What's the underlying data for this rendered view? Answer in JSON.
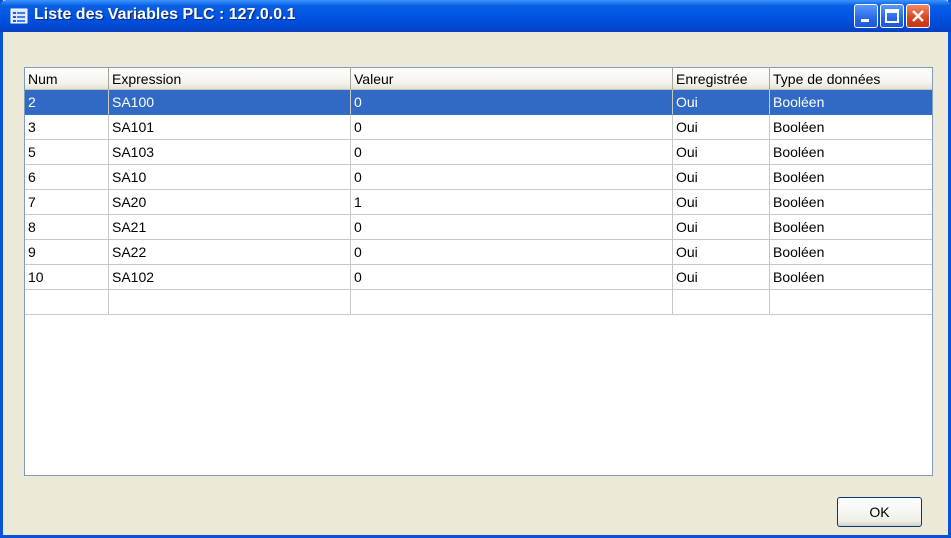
{
  "window": {
    "title": "Liste des Variables PLC : 127.0.0.1",
    "colors": {
      "titlebar": "#0054e3",
      "selection": "#316ac5",
      "frame": "#ece9d8"
    }
  },
  "table": {
    "columns": [
      "Num",
      "Expression",
      "Valeur",
      "Enregistrée",
      "Type de données"
    ],
    "rows": [
      [
        "2",
        "SA100",
        "0",
        "Oui",
        "Booléen"
      ],
      [
        "3",
        "SA101",
        "0",
        "Oui",
        "Booléen"
      ],
      [
        "5",
        "SA103",
        "0",
        "Oui",
        "Booléen"
      ],
      [
        "6",
        "SA10",
        "0",
        "Oui",
        "Booléen"
      ],
      [
        "7",
        "SA20",
        "1",
        "Oui",
        "Booléen"
      ],
      [
        "8",
        "SA21",
        "0",
        "Oui",
        "Booléen"
      ],
      [
        "9",
        "SA22",
        "0",
        "Oui",
        "Booléen"
      ],
      [
        "10",
        "SA102",
        "0",
        "Oui",
        "Booléen"
      ],
      [
        "",
        "",
        "",
        "",
        ""
      ]
    ],
    "selected_row": 0
  },
  "buttons": {
    "ok": "OK"
  }
}
